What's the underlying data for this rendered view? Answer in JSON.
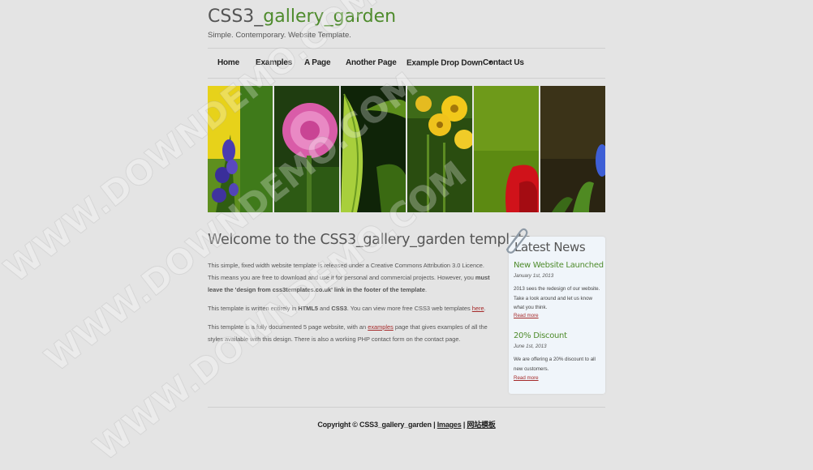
{
  "header": {
    "logo_prefix": "CSS3_",
    "logo_highlight": "gallery_garden",
    "slogan": "Simple. Contemporary. Website Template."
  },
  "nav": {
    "items": [
      "Home",
      "Examples",
      "A Page",
      "Another Page",
      "Example Drop Down",
      "Contact Us"
    ]
  },
  "gallery": {
    "images": [
      "blue-flowers",
      "pink-thistle",
      "green-leaf",
      "yellow-daisies",
      "red-flower",
      "blue-bloom"
    ]
  },
  "content": {
    "title": "Welcome to the CSS3_gallery_garden template",
    "p1_a": "This simple, fixed width website template is released under a Creative Commons Attribution 3.0 Licence. This means you are free to download and use it for personal and commercial projects. However, you ",
    "p1_b": "must leave the 'design from css3templates.co.uk' link in the footer of the template",
    "p1_c": ".",
    "p2_a": "This template is written entirely in ",
    "p2_b": "HTML5",
    "p2_c": " and ",
    "p2_d": "CSS3",
    "p2_e": ". You can view more free CSS3 web templates ",
    "p2_link": "here",
    "p2_f": ".",
    "p3_a": "This template is a fully documented 5 page website, with an ",
    "p3_link": "examples",
    "p3_b": " page that gives examples of all the styles available with this design. There is also a working PHP contact form on the contact page."
  },
  "sidebar": {
    "title": "Latest News",
    "news": [
      {
        "title": "New Website Launched",
        "date": "January 1st, 2013",
        "body": "2013 sees the redesign of our website. Take a look around and let us know what you think.",
        "link": "Read more"
      },
      {
        "title": "20% Discount",
        "date": "June 1st, 2013",
        "body": "We are offering a 20% discount to all new customers.",
        "link": "Read more"
      }
    ]
  },
  "footer": {
    "copyright": "Copyright © CSS3_gallery_garden",
    "sep1": " | ",
    "link1": "Images",
    "sep2": " | ",
    "link2": "网站模板"
  },
  "watermark": {
    "text": "WWW.DOWNDEMO.COM"
  },
  "colors": {
    "background": "#e4e4e4",
    "accent_green": "#4e8b2c",
    "link_red": "#a52a2a",
    "sidebar_bg": "#f0f5fa"
  }
}
